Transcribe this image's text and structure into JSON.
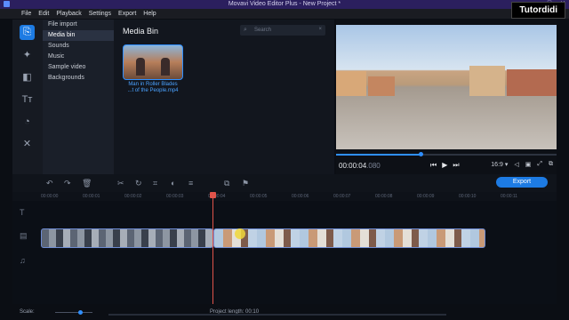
{
  "window": {
    "title": "Movavi Video Editor Plus - New Project *",
    "buttons": [
      "—",
      "□",
      "✕"
    ]
  },
  "brand": "Tutordidi",
  "menu": [
    "File",
    "Edit",
    "Playback",
    "Settings",
    "Export",
    "Help"
  ],
  "tools": [
    {
      "name": "import",
      "glyph": "⎘",
      "active": true
    },
    {
      "name": "filters",
      "glyph": "✦",
      "active": false
    },
    {
      "name": "transitions",
      "glyph": "◧",
      "active": false
    },
    {
      "name": "titles",
      "glyph": "Tт",
      "active": false
    },
    {
      "name": "stickers",
      "glyph": "◔",
      "active": false
    },
    {
      "name": "more-tools",
      "glyph": "✕",
      "active": false
    }
  ],
  "sidenav": [
    "File import",
    "Media bin",
    "Sounds",
    "Music",
    "Sample video",
    "Backgrounds"
  ],
  "media_bin": {
    "title": "Media Bin",
    "search_placeholder": "Search",
    "item_caption_line1": "Man in Roller Blades",
    "item_caption_line2": "...t of the People.mp4"
  },
  "player": {
    "timecode": "00:00:04",
    "timecode_ms": ".080",
    "aspect": "16:9 ▾",
    "progress": 0.39
  },
  "export_label": "Export",
  "ruler": [
    "00:00:00",
    "00:00:01",
    "00:00:02",
    "00:00:03",
    "00:00:04",
    "00:00:05",
    "00:00:06",
    "00:00:07",
    "00:00:08",
    "00:00:09",
    "00:00:10",
    "00:00:11"
  ],
  "status": {
    "scale_label": "Scale:",
    "project_length": "Project length:  00:10"
  }
}
